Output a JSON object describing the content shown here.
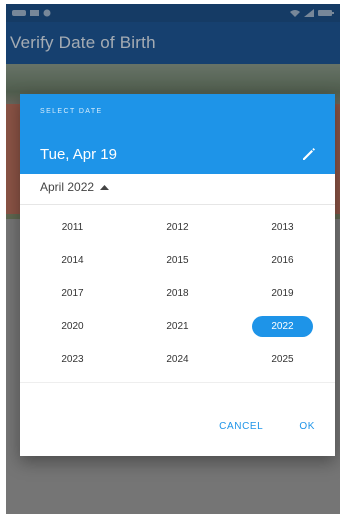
{
  "appbar": {
    "title": "Verify Date of Birth"
  },
  "picker": {
    "header_label": "SELECT DATE",
    "selected_date": "Tue, Apr 19",
    "month_label": "April 2022",
    "years": [
      "2011",
      "2012",
      "2013",
      "2014",
      "2015",
      "2016",
      "2017",
      "2018",
      "2019",
      "2020",
      "2021",
      "2022",
      "2023",
      "2024",
      "2025"
    ],
    "selected_year": "2022",
    "cancel_label": "CANCEL",
    "ok_label": "OK"
  },
  "colors": {
    "accent": "#1e94e8",
    "appbar": "#1e5694"
  },
  "icons": {
    "edit": "pencil-icon",
    "dropdown": "caret-up-icon"
  }
}
